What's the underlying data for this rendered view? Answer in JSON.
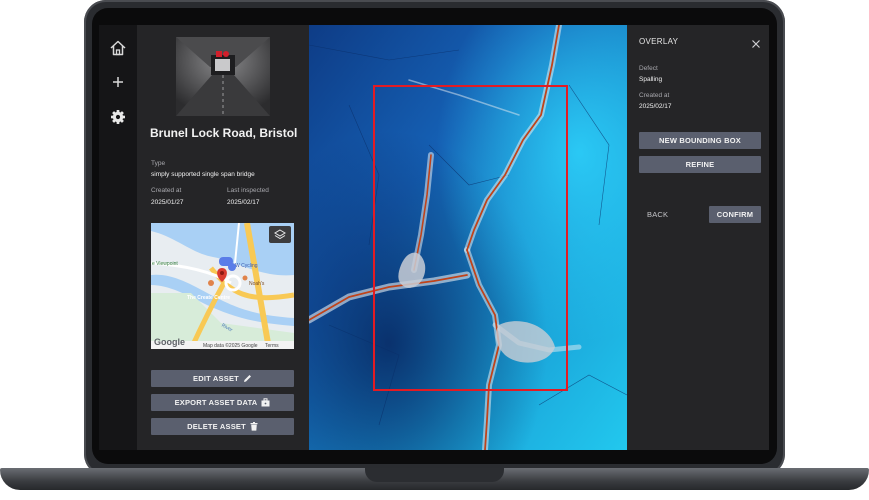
{
  "nav": {
    "items": [
      {
        "icon": "home-icon"
      },
      {
        "icon": "plus-icon"
      },
      {
        "icon": "gear-icon"
      }
    ]
  },
  "asset": {
    "title": "Brunel Lock Road, Bristol",
    "type_label": "Type",
    "type_value": "simply supported single span bridge",
    "created_label": "Created at",
    "created_value": "2025/01/27",
    "inspected_label": "Last inspected",
    "inspected_value": "2025/02/17"
  },
  "map": {
    "place_1": "e Viewpoint",
    "place_2": "W Cycling",
    "place_3": "Noah's",
    "place_4": "The Create Centre",
    "place_5": "River",
    "brand": "Google",
    "attribution": "Map data ©2025 Google",
    "terms": "Terms",
    "layers_icon": "layers-icon"
  },
  "actions": {
    "edit_label": "EDIT ASSET",
    "export_label": "EXPORT ASSET DATA",
    "delete_label": "DELETE ASSET"
  },
  "overlay": {
    "title": "OVERLAY",
    "defect_label": "Defect",
    "defect_value": "Spalling",
    "created_label": "Created at",
    "created_value": "2025/02/17",
    "new_box_label": "NEW BOUNDING BOX",
    "refine_label": "REFINE",
    "back_label": "BACK",
    "confirm_label": "CONFIRM"
  },
  "colors": {
    "accent_button": "#5a5f6e",
    "bounding_box": "#e31b23",
    "panel": "#252527",
    "nav": "#151517"
  }
}
